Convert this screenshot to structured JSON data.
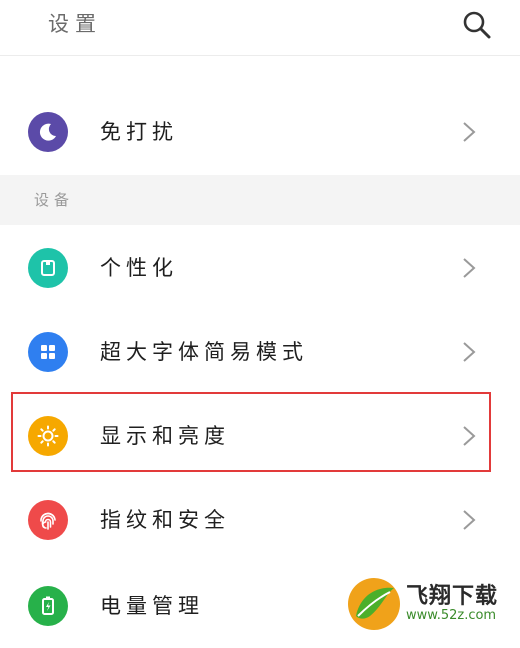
{
  "header": {
    "title": "设置",
    "search_icon": "search-icon"
  },
  "items_top": [
    {
      "label": "免打扰",
      "icon": "moon-icon",
      "color": "#5b4aa8"
    }
  ],
  "section": {
    "label": "设备"
  },
  "items_device": [
    {
      "label": "个性化",
      "icon": "theme-icon",
      "color": "#1ec3a9"
    },
    {
      "label": "超大字体简易模式",
      "icon": "grid-icon",
      "color": "#2f7ff0"
    },
    {
      "label": "显示和亮度",
      "icon": "sun-icon",
      "color": "#f6a800",
      "highlighted": true
    },
    {
      "label": "指纹和安全",
      "icon": "fingerprint-icon",
      "color": "#ef4a4a"
    },
    {
      "label": "电量管理",
      "icon": "battery-icon",
      "color": "#27b14a"
    }
  ],
  "colors": {
    "highlight_border": "#e23a3a",
    "section_background": "#f4f4f4"
  },
  "watermark": {
    "text": "飞翔下载",
    "url": "www.52z.com"
  }
}
